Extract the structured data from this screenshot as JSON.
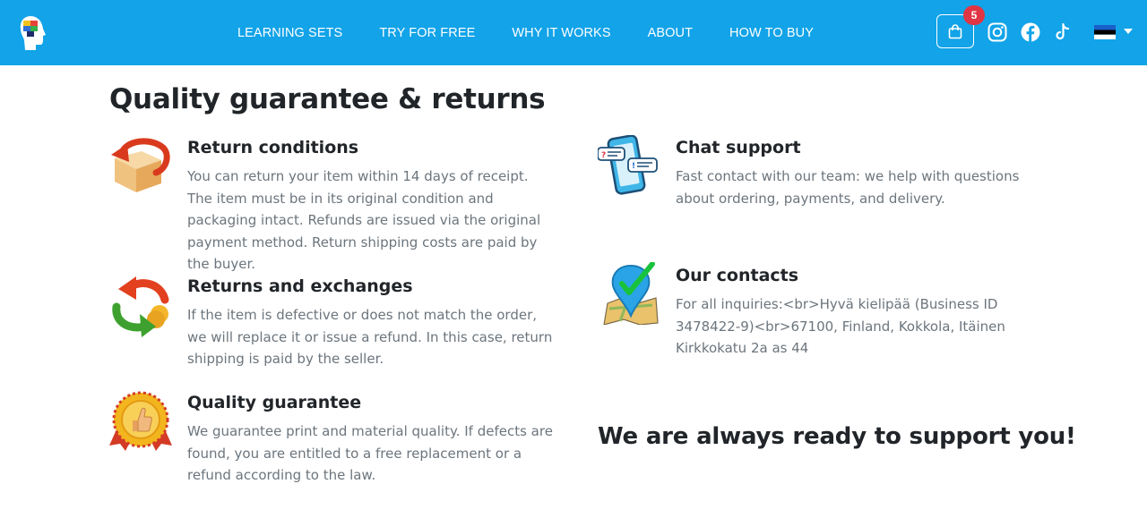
{
  "header": {
    "logo_name": "brand-logo",
    "nav": [
      {
        "label": "LEARNING SETS"
      },
      {
        "label": "TRY FOR FREE"
      },
      {
        "label": "WHY IT WORKS"
      },
      {
        "label": "ABOUT"
      },
      {
        "label": "HOW TO BUY"
      }
    ],
    "cart_count": "5",
    "social": [
      "instagram-icon",
      "facebook-icon",
      "tiktok-icon"
    ],
    "language_flag": "estonia-flag",
    "colors": {
      "bar": "#12a3e8",
      "badge": "#e03545"
    }
  },
  "page": {
    "title": "Quality guarantee & returns",
    "left_items": [
      {
        "icon": "return-box-icon",
        "title": "Return conditions",
        "text": "You can return your item within 14 days of receipt. The item must be in its original condition and packaging intact. Refunds are issued via the original payment method. Return shipping costs are paid by the buyer."
      },
      {
        "icon": "exchange-arrows-icon",
        "title": "Returns and exchanges",
        "text": "If the item is defective or does not match the order, we will replace it or issue a refund. In this case, return shipping is paid by the seller."
      },
      {
        "icon": "quality-medal-icon",
        "title": "Quality guarantee",
        "text": "We guarantee print and material quality. If defects are found, you are entitled to a free replacement or a refund according to the law."
      }
    ],
    "right_items": [
      {
        "icon": "chat-phone-icon",
        "title": "Chat support",
        "text": "Fast contact with our team: we help with questions about ordering, payments, and delivery."
      },
      {
        "icon": "map-pin-icon",
        "title": "Our contacts",
        "text": "For all inquiries:<br>Hyvä kielipää (Business ID 3478422-9)<br>67100, Finland, Kokkola, Itäinen Kirkkokatu 2a as 44"
      }
    ],
    "support_text": "We are always ready to support you!"
  }
}
